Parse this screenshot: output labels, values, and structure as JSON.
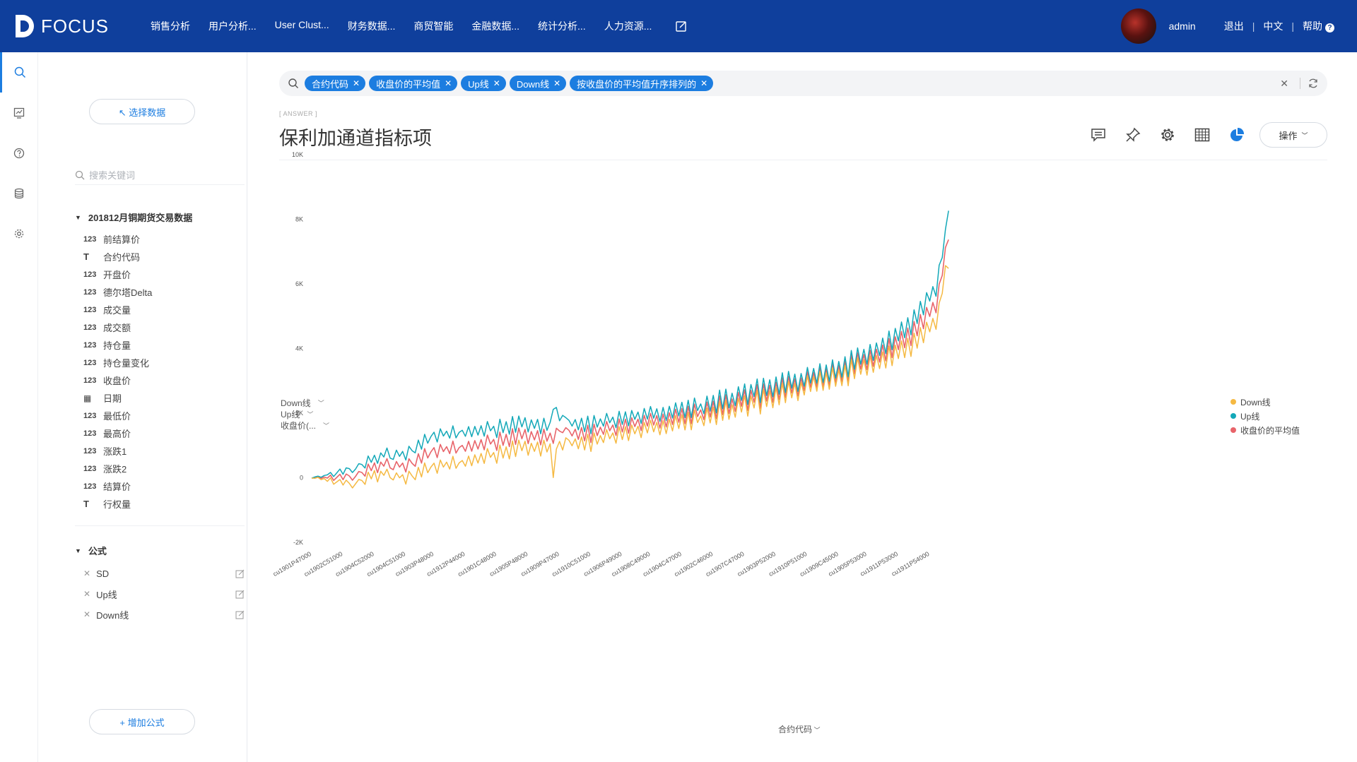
{
  "app": {
    "logo_text": "FOCUS",
    "nav": [
      "销售分析",
      "用户分析...",
      "User Clust...",
      "财务数据...",
      "商贸智能",
      "金融数据...",
      "统计分析...",
      "人力资源..."
    ],
    "user": "admin",
    "logout": "退出",
    "lang": "中文",
    "help": "帮助"
  },
  "sidebar": {
    "pick_data": "↖ 选择数据",
    "search_placeholder": "搜索关键词",
    "dataset_title": "201812月铜期货交易数据",
    "fields": [
      {
        "type": "123",
        "name": "前结算价"
      },
      {
        "type": "T",
        "name": "合约代码"
      },
      {
        "type": "123",
        "name": "开盘价"
      },
      {
        "type": "123",
        "name": "德尔塔Delta"
      },
      {
        "type": "123",
        "name": "成交量"
      },
      {
        "type": "123",
        "name": "成交额"
      },
      {
        "type": "123",
        "name": "持仓量"
      },
      {
        "type": "123",
        "name": "持仓量变化"
      },
      {
        "type": "123",
        "name": "收盘价"
      },
      {
        "type": "date",
        "name": "日期"
      },
      {
        "type": "123",
        "name": "最低价"
      },
      {
        "type": "123",
        "name": "最高价"
      },
      {
        "type": "123",
        "name": "涨跌1"
      },
      {
        "type": "123",
        "name": "涨跌2"
      },
      {
        "type": "123",
        "name": "结算价"
      },
      {
        "type": "T",
        "name": "行权量"
      }
    ],
    "formula_title": "公式",
    "formulas": [
      "SD",
      "Up线",
      "Down线"
    ],
    "add_formula": "+ 增加公式"
  },
  "query": {
    "chips": [
      "合约代码",
      "收盘价的平均值",
      "Up线",
      "Down线",
      "按收盘价的平均值升序排列的"
    ]
  },
  "answer": {
    "tag": "[ ANSWER ]",
    "title": "保利加通道指标项",
    "op_label": "操作"
  },
  "colors": {
    "brand": "#0f3f9c",
    "accent": "#1c7de0",
    "down": "#f5b942",
    "up": "#13a8b8",
    "avg": "#e8646a"
  },
  "chart_data": {
    "type": "line",
    "y_selectors": [
      "Down线",
      "Up线",
      "收盘价(..."
    ],
    "x_selector": "合约代码",
    "ylim": [
      -2000,
      10000
    ],
    "yticks": [
      -2000,
      0,
      2000,
      4000,
      6000,
      8000,
      10000
    ],
    "ytick_labels": [
      "-2K",
      "0",
      "2K",
      "4K",
      "6K",
      "8K",
      "10K"
    ],
    "n_points": 206,
    "xtick_labels": [
      "cu1901P47000",
      "cu1902C51000",
      "cu1904C52000",
      "cu1904C51000",
      "cu1903P48000",
      "cu1912P44000",
      "cu1901C48000",
      "cu1905P48000",
      "cu1909P47000",
      "cu1910C51000",
      "cu1906P49000",
      "cu1908C49000",
      "cu1904C47000",
      "cu1902C46000",
      "cu1907C47000",
      "cu1903P52000",
      "cu1910P51000",
      "cu1909C45000",
      "cu1905P53000",
      "cu1911P53000",
      "cu1911P54000"
    ],
    "series": [
      {
        "name": "Down线",
        "color": "#f5b942",
        "values": [
          -12,
          -17,
          13,
          -59,
          -26,
          -112,
          -3,
          -201,
          -129,
          -55,
          -228,
          -75,
          -174,
          -314,
          -185,
          -53,
          -83,
          -205,
          172,
          -36,
          223,
          -130,
          202,
          74,
          264,
          2,
          -68,
          151,
          -3,
          94,
          -197,
          203,
          58,
          -61,
          322,
          24,
          460,
          155,
          331,
          452,
          138,
          548,
          330,
          482,
          269,
          664,
          293,
          460,
          534,
          356,
          671,
          372,
          710,
          454,
          753,
          443,
          904,
          631,
          780,
          447,
          1015,
          609,
          958,
          582,
          1139,
          656,
          1164,
          838,
          1130,
          694,
          1066,
          815,
          1107,
          670,
          1162,
          798,
          1052,
          7,
          888,
          1126,
          859,
          1237,
          1160,
          991,
          1205,
          896,
          1265,
          861,
          1346,
          814,
          1388,
          1040,
          1305,
          1088,
          1489,
          1205,
          1389,
          1068,
          1580,
          1183,
          1580,
          1149,
          1631,
          1360,
          1595,
          1242,
          1712,
          1387,
          1782,
          1420,
          1716,
          1329,
          1766,
          1366,
          1809,
          1450,
          1926,
          1524,
          1950,
          1480,
          2022,
          1485,
          2093,
          1707,
          1915,
          1612,
          2159,
          1697,
          2186,
          1646,
          2353,
          1775,
          2388,
          1808,
          2260,
          1873,
          2458,
          2032,
          2542,
          1906,
          2527,
          2159,
          2704,
          1973,
          2732,
          2203,
          2688,
          2166,
          2790,
          2258,
          2930,
          2324,
          2983,
          2474,
          2920,
          2390,
          2950,
          2562,
          3151,
          2668,
          3129,
          2677,
          3284,
          2704,
          3248,
          2738,
          3401,
          2830,
          3342,
          2850,
          3477,
          2848,
          3654,
          3066,
          3714,
          3203,
          3650,
          3175,
          3770,
          3263,
          3786,
          3378,
          3897,
          3397,
          4077,
          3472,
          4102,
          3690,
          4236,
          3717,
          4318,
          3754,
          4476,
          4011,
          4647,
          4179,
          4816,
          4516,
          4932,
          4593,
          5406,
          5709,
          6566,
          6478
        ]
      },
      {
        "name": "Up线",
        "color": "#13a8b8",
        "values": [
          -12,
          23,
          51,
          16,
          69,
          90,
          164,
          37,
          150,
          268,
          108,
          305,
          282,
          162,
          271,
          436,
          411,
          302,
          673,
          476,
          698,
          445,
          770,
          642,
          920,
          607,
          566,
          855,
          662,
          815,
          548,
          975,
          840,
          771,
          1165,
          882,
          1345,
          1068,
          1274,
          1409,
          1107,
          1514,
          1292,
          1440,
          1224,
          1606,
          1236,
          1404,
          1468,
          1283,
          1582,
          1271,
          1589,
          1320,
          1612,
          1288,
          1740,
          1453,
          1594,
          1244,
          1813,
          1394,
          1735,
          1348,
          1894,
          1408,
          1911,
          1573,
          1861,
          1417,
          1793,
          1527,
          1808,
          1362,
          1843,
          1466,
          1713,
          2117,
          2177,
          1763,
          1929,
          1860,
          1776,
          1599,
          1802,
          1484,
          1843,
          1426,
          1908,
          1365,
          1926,
          1568,
          1824,
          1598,
          1991,
          1700,
          1877,
          1550,
          2057,
          1650,
          2042,
          1607,
          2084,
          1808,
          2036,
          1680,
          2145,
          1815,
          2206,
          1842,
          2135,
          1744,
          2177,
          1775,
          2213,
          1847,
          2320,
          1914,
          2336,
          1863,
          2401,
          1862,
          2467,
          2081,
          2287,
          1983,
          2526,
          2063,
          2549,
          2007,
          2713,
          2133,
          2743,
          2164,
          2617,
          2232,
          2817,
          2393,
          2904,
          2266,
          2886,
          2516,
          3058,
          2327,
          3080,
          2547,
          3031,
          2504,
          3122,
          2585,
          3249,
          2638,
          3291,
          2772,
          3208,
          2671,
          3226,
          2833,
          3416,
          2928,
          3384,
          2927,
          3531,
          2949,
          3492,
          2985,
          3650,
          3084,
          3599,
          3113,
          3747,
          3125,
          3939,
          3359,
          4020,
          3518,
          3976,
          3515,
          4125,
          3632,
          4172,
          3783,
          4321,
          3842,
          4540,
          3962,
          4623,
          4237,
          4822,
          4333,
          4952,
          4425,
          5197,
          4774,
          5461,
          5042,
          5730,
          5468,
          5918,
          5616,
          6579,
          6816,
          7688,
          8264
        ]
      },
      {
        "name": "收盘价的平均值",
        "color": "#e8646a",
        "values": [
          -12,
          3,
          32,
          -22,
          22,
          -11,
          81,
          -82,
          11,
          107,
          -60,
          115,
          54,
          -76,
          43,
          192,
          164,
          48,
          423,
          220,
          461,
          158,
          486,
          358,
          592,
          305,
          249,
          503,
          330,
          455,
          176,
          589,
          449,
          355,
          744,
          453,
          903,
          612,
          803,
          931,
          623,
          1031,
          811,
          961,
          747,
          1135,
          765,
          932,
          1001,
          820,
          1127,
          822,
          1150,
          887,
          1183,
          866,
          1322,
          1042,
          1187,
          846,
          1414,
          1002,
          1347,
          965,
          1517,
          1032,
          1538,
          1206,
          1496,
          1056,
          1430,
          1171,
          1458,
          1016,
          1503,
          1132,
          1383,
          1062,
          1533,
          1445,
          1394,
          1549,
          1468,
          1295,
          1504,
          1190,
          1554,
          1144,
          1627,
          1090,
          1657,
          1304,
          1565,
          1343,
          1740,
          1453,
          1633,
          1309,
          1819,
          1417,
          1811,
          1378,
          1858,
          1584,
          1815,
          1461,
          1929,
          1601,
          1994,
          1631,
          1926,
          1537,
          1971,
          1571,
          2011,
          1649,
          2123,
          1719,
          2143,
          1672,
          2212,
          1674,
          2280,
          1894,
          2101,
          1798,
          2343,
          1880,
          2368,
          1827,
          2533,
          1954,
          2566,
          1986,
          2439,
          2053,
          2638,
          2213,
          2723,
          2086,
          2707,
          2338,
          2881,
          2150,
          2906,
          2375,
          2860,
          2335,
          2956,
          2422,
          3090,
          2481,
          3137,
          2623,
          3064,
          2531,
          3088,
          2698,
          3284,
          2798,
          3257,
          2802,
          3408,
          2827,
          3370,
          2862,
          3526,
          2957,
          3471,
          2982,
          3612,
          2987,
          3797,
          3213,
          3867,
          3361,
          3813,
          3345,
          3948,
          3448,
          3979,
          3581,
          4109,
          3620,
          4309,
          3717,
          4363,
          3964,
          4529,
          4025,
          4635,
          4090,
          4837,
          4393,
          5054,
          4611,
          5273,
          4992,
          5425,
          5105,
          5993,
          6263,
          7127,
          7371
        ]
      }
    ],
    "legend": [
      "Down线",
      "Up线",
      "收盘价的平均值"
    ],
    "legend_position": "right"
  }
}
